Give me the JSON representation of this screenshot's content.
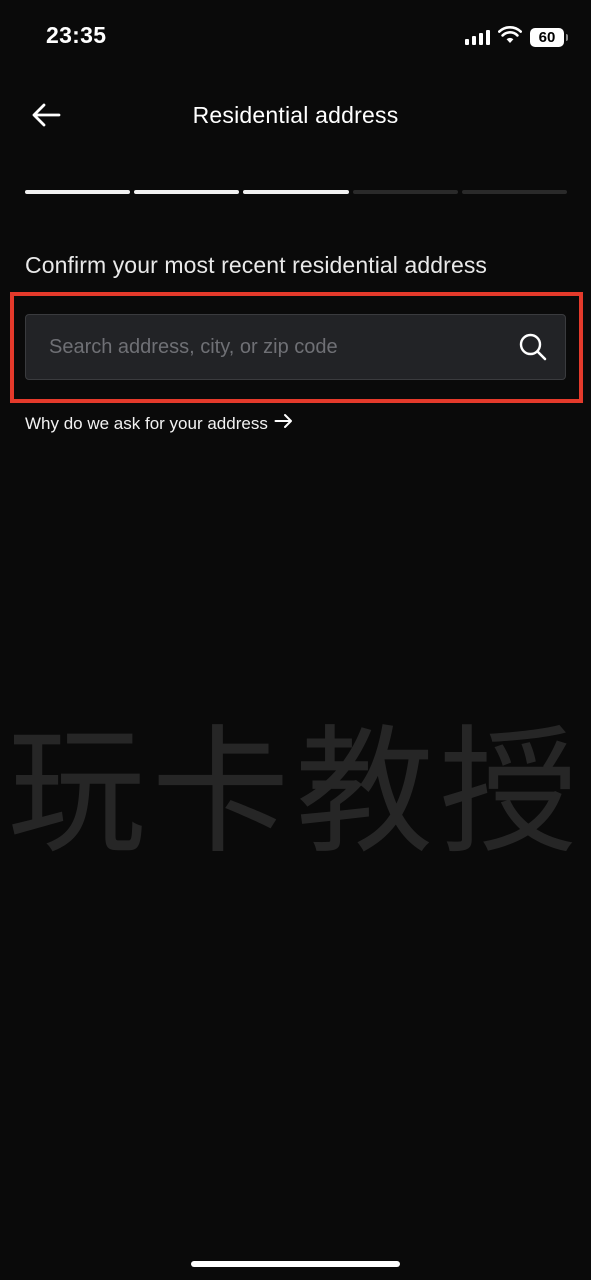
{
  "status_bar": {
    "time": "23:35",
    "battery": "60"
  },
  "header": {
    "title": "Residential address",
    "back_icon": "arrow-left-icon"
  },
  "progress": {
    "total_steps": 5,
    "completed_steps": 3
  },
  "form": {
    "prompt": "Confirm your most recent residential address",
    "search": {
      "value": "",
      "placeholder": "Search address, city, or zip code",
      "icon": "search-icon"
    },
    "why_link": "Why do we ask for your address",
    "why_link_icon": "arrow-right-icon"
  },
  "watermark": "玩卡教授",
  "colors": {
    "background": "#0a0a0a",
    "highlight": "#e53a2b",
    "input_bg": "#222326"
  }
}
